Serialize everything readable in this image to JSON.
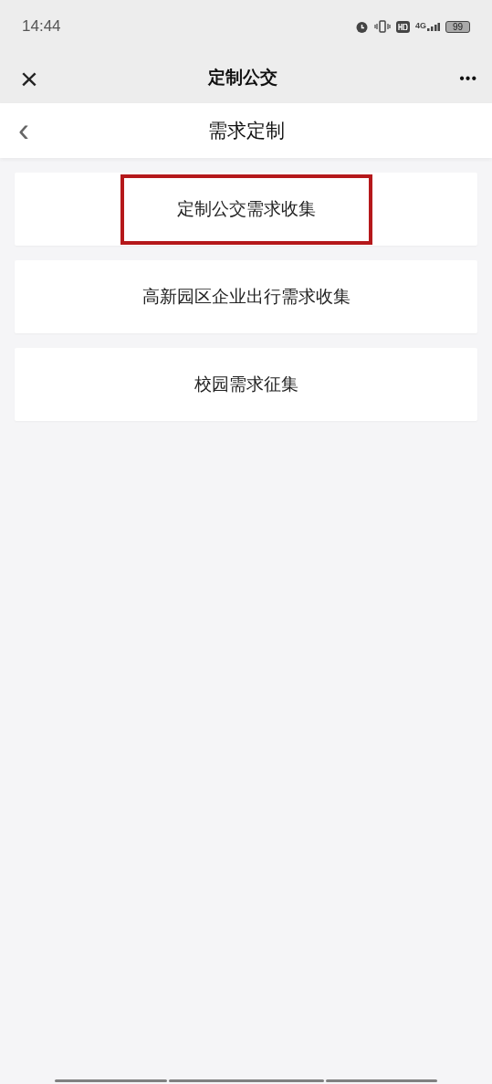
{
  "status_bar": {
    "time": "14:44",
    "network": "4G",
    "battery": "99"
  },
  "header": {
    "close": "×",
    "title": "定制公交",
    "more": "•••"
  },
  "subheader": {
    "back": "‹",
    "title": "需求定制"
  },
  "items": [
    {
      "label": "定制公交需求收集",
      "highlighted": true
    },
    {
      "label": "高新园区企业出行需求收集",
      "highlighted": false
    },
    {
      "label": "校园需求征集",
      "highlighted": false
    }
  ]
}
